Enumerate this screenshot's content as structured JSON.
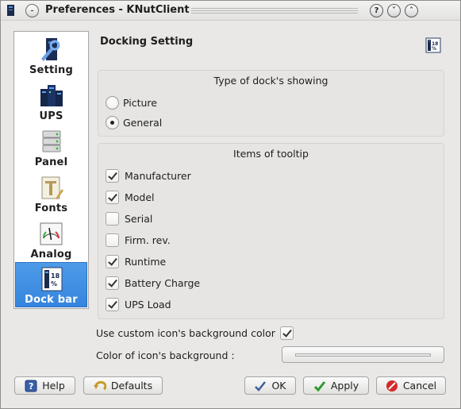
{
  "window": {
    "title": "Preferences - KNutClient",
    "help_glyph": "?",
    "minimize_glyph": "˅",
    "maximize_glyph": "˄"
  },
  "sidebar": {
    "items": [
      {
        "label": "Setting",
        "icon": "setting-icon",
        "active": false
      },
      {
        "label": "UPS",
        "icon": "ups-icon",
        "active": false
      },
      {
        "label": "Panel",
        "icon": "panel-icon",
        "active": false
      },
      {
        "label": "Fonts",
        "icon": "fonts-icon",
        "active": false
      },
      {
        "label": "Analog",
        "icon": "analog-gauge-icon",
        "active": false
      },
      {
        "label": "Dock bar",
        "icon": "dock-bar-icon",
        "active": true
      }
    ]
  },
  "page": {
    "heading": "Docking Setting"
  },
  "dock_type": {
    "title": "Type of dock's showing",
    "options": [
      {
        "label": "Picture",
        "selected": false
      },
      {
        "label": "General",
        "selected": true
      }
    ]
  },
  "tooltip_items": {
    "title": "Items of tooltip",
    "items": [
      {
        "label": "Manufacturer",
        "checked": true
      },
      {
        "label": "Model",
        "checked": true
      },
      {
        "label": "Serial",
        "checked": false
      },
      {
        "label": "Firm. rev.",
        "checked": false
      },
      {
        "label": "Runtime",
        "checked": true
      },
      {
        "label": "Battery Charge",
        "checked": true
      },
      {
        "label": "UPS Load",
        "checked": true
      }
    ]
  },
  "custom_bg": {
    "label": "Use custom icon's background color",
    "checked": true
  },
  "icon_bg": {
    "label": "Color of icon's background :",
    "color": "#e8e8e8"
  },
  "buttons": {
    "help": "Help",
    "defaults": "Defaults",
    "ok": "OK",
    "apply": "Apply",
    "cancel": "Cancel"
  },
  "colors": {
    "accent": "#3d8ee3",
    "window_bg": "#e9e8e6"
  }
}
